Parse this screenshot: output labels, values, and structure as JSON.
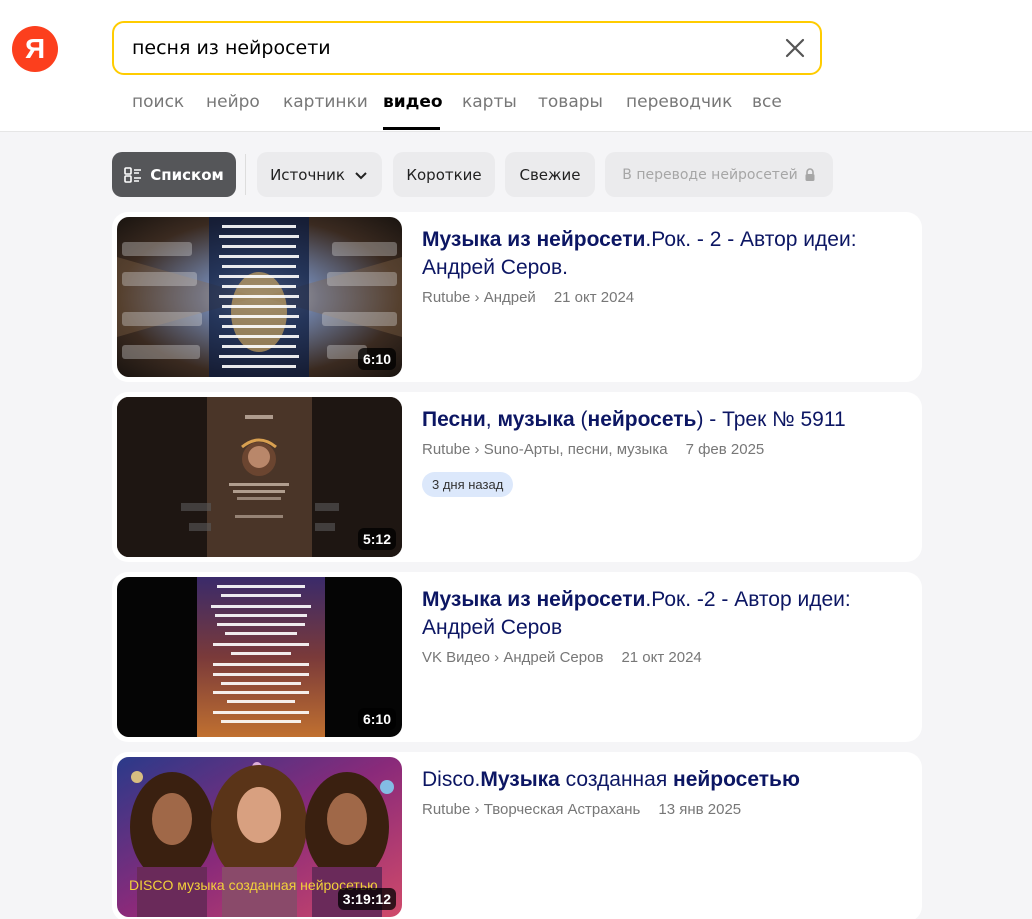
{
  "header": {
    "logo_letter": "Я",
    "search_value": "песня из нейросети",
    "clear_icon": "close-icon"
  },
  "nav": {
    "tabs": [
      {
        "label": "поиск",
        "active": false
      },
      {
        "label": "нейро",
        "active": false
      },
      {
        "label": "картинки",
        "active": false
      },
      {
        "label": "видео",
        "active": true
      },
      {
        "label": "карты",
        "active": false
      },
      {
        "label": "товары",
        "active": false
      },
      {
        "label": "переводчик",
        "active": false
      },
      {
        "label": "все",
        "active": false
      }
    ]
  },
  "filters": {
    "list_view": "Списком",
    "list_icon": "list-view-icon",
    "source": "Источник",
    "source_icon": "chevron-down-icon",
    "short": "Короткие",
    "fresh": "Свежие",
    "translated": "В переводе нейросетей",
    "translated_icon": "lock-icon"
  },
  "results": [
    {
      "title_parts": [
        {
          "text": "Музыка из нейросети",
          "bold": true
        },
        {
          "text": ".Рок. - 2 - Автор идеи: Андрей Серов.",
          "bold": false
        }
      ],
      "source": "Rutube › Андрей",
      "date": "21 окт 2024",
      "duration": "6:10",
      "badge": ""
    },
    {
      "title_parts": [
        {
          "text": "Песни",
          "bold": true
        },
        {
          "text": ", ",
          "bold": false
        },
        {
          "text": "музыка",
          "bold": true
        },
        {
          "text": " (",
          "bold": false
        },
        {
          "text": "нейросеть",
          "bold": true
        },
        {
          "text": ") - Трек № 5911",
          "bold": false
        }
      ],
      "source": "Rutube › Suno-Арты, песни, музыка",
      "date": "7 фев 2025",
      "duration": "5:12",
      "badge": "3 дня назад"
    },
    {
      "title_parts": [
        {
          "text": "Музыка из нейросети",
          "bold": true
        },
        {
          "text": ".Рок. -2 - Автор идеи: Андрей Серов",
          "bold": false
        }
      ],
      "source": "VK Видео › Андрей Серов",
      "date": "21 окт 2024",
      "duration": "6:10",
      "badge": ""
    },
    {
      "title_parts": [
        {
          "text": "Disco.",
          "bold": false
        },
        {
          "text": "Музыка",
          "bold": true
        },
        {
          "text": " созданная ",
          "bold": false
        },
        {
          "text": "нейросетью",
          "bold": true
        }
      ],
      "source": "Rutube › Творческая Астрахань",
      "date": "13 янв 2025",
      "duration": "3:19:12",
      "badge": "",
      "thumb_caption": "DISCO музыка созданная нейросетью"
    }
  ]
}
